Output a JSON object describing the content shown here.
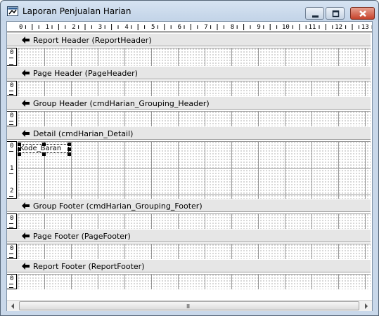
{
  "window": {
    "title": "Laporan Penjualan Harian",
    "controls": {
      "minimize": "minimize",
      "maximize": "maximize",
      "close": "close"
    }
  },
  "ruler": {
    "ticks": [
      "0",
      "1",
      "2",
      "3",
      "4",
      "5",
      "6",
      "7",
      "8",
      "9",
      "10",
      "11",
      "12",
      "13"
    ]
  },
  "sections": [
    {
      "label": "Report Header (ReportHeader)",
      "ruler_labels": [
        "0"
      ]
    },
    {
      "label": "Page Header (PageHeader)",
      "ruler_labels": [
        "0"
      ]
    },
    {
      "label": "Group Header (cmdHarian_Grouping_Header)",
      "ruler_labels": [
        "0"
      ]
    },
    {
      "label": "Detail (cmdHarian_Detail)",
      "ruler_labels": [
        "0",
        "1",
        "2"
      ]
    },
    {
      "label": "Group Footer (cmdHarian_Grouping_Footer)",
      "ruler_labels": [
        "0"
      ]
    },
    {
      "label": "Page Footer (PageFooter)",
      "ruler_labels": [
        "0"
      ]
    },
    {
      "label": "Report Footer (ReportFooter)",
      "ruler_labels": [
        "0"
      ]
    }
  ],
  "detail_field": {
    "text": "Kode_Baran"
  },
  "scrollbar": {
    "grip": "III"
  },
  "colors": {
    "title_bar": "#c3d4e8",
    "close_button": "#c6422b",
    "section_bar": "#e6e6e6"
  }
}
